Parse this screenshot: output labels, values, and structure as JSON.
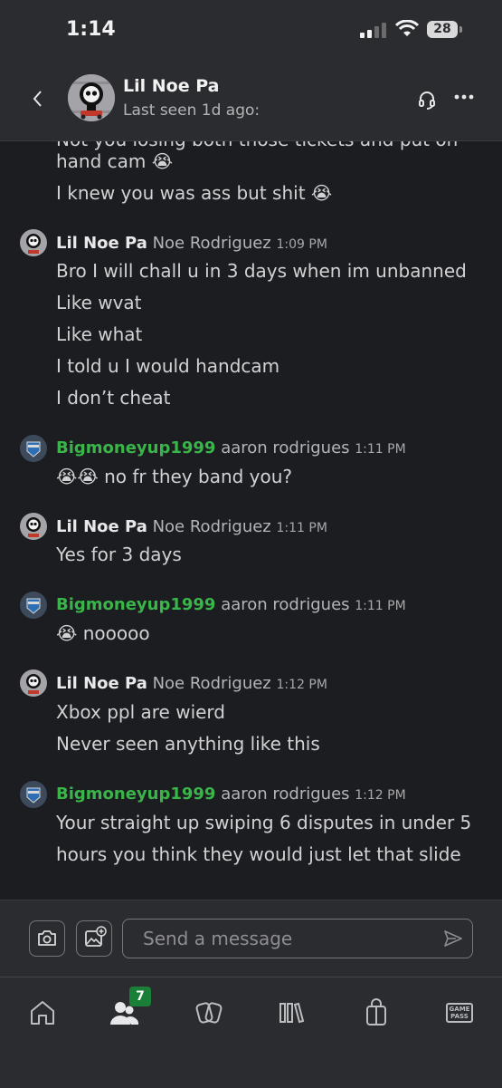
{
  "status_bar": {
    "time": "1:14",
    "battery": "28"
  },
  "header": {
    "name": "Lil Noe Pa",
    "last_seen": "Last seen 1d ago:"
  },
  "messages": {
    "clipped_line": "Not you losing both those tickets and put on",
    "top_lines": [
      "hand cam 😭",
      "I knew you was ass but shit 😭"
    ],
    "groups": [
      {
        "name": "Lil Noe Pa",
        "realname": "Noe Rodriguez",
        "time": "1:09 PM",
        "lines": [
          "Bro I will chall u in 3 days when im unbanned",
          "Like wvat",
          "Like what",
          "I told u I would handcam",
          "I don’t cheat"
        ]
      },
      {
        "name": "Bigmoneyup1999",
        "realname": "aaron rodrigues",
        "time": "1:11 PM",
        "lines": [
          "😭😭 no fr they band you?"
        ]
      },
      {
        "name": "Lil Noe Pa",
        "realname": "Noe Rodriguez",
        "time": "1:11 PM",
        "lines": [
          "Yes for 3 days"
        ]
      },
      {
        "name": "Bigmoneyup1999",
        "realname": "aaron rodrigues",
        "time": "1:11 PM",
        "lines": [
          "😭 nooooo"
        ]
      },
      {
        "name": "Lil Noe Pa",
        "realname": "Noe Rodriguez",
        "time": "1:12 PM",
        "lines": [
          "Xbox ppl are wierd",
          "Never seen anything like this"
        ]
      },
      {
        "name": "Bigmoneyup1999",
        "realname": "aaron rodrigues",
        "time": "1:12 PM",
        "lines": [
          "Your straight up swiping 6 disputes in under 5",
          "hours you think they would just let that slide"
        ]
      }
    ]
  },
  "composer": {
    "placeholder": "Send a message"
  },
  "tabbar": {
    "friends_badge": "7",
    "gamepass_label_1": "GAME",
    "gamepass_label_2": "PASS"
  },
  "colors": {
    "accent_green": "#3ab54a",
    "badge_green": "#1a7f37",
    "background": "#1c1d21",
    "bar": "#2b2c30"
  }
}
